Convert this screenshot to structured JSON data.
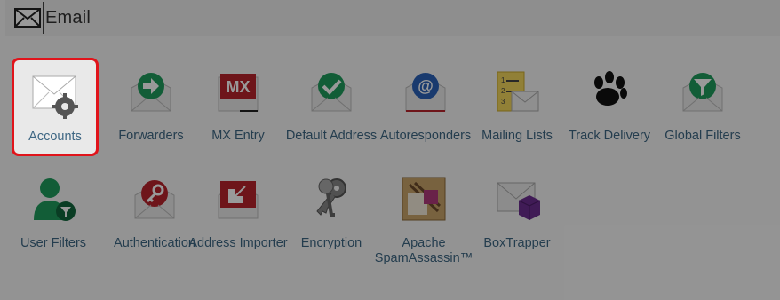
{
  "section": {
    "title": "Email",
    "icon": "envelope-icon"
  },
  "items": [
    {
      "label": "Accounts",
      "icon": "email-accounts-gear-icon",
      "selected": true
    },
    {
      "label": "Forwarders",
      "icon": "forwarder-arrow-icon"
    },
    {
      "label": "MX Entry",
      "icon": "mx-entry-icon",
      "badge": "MX"
    },
    {
      "label": "Default Address",
      "icon": "default-address-check-icon"
    },
    {
      "label": "Autoresponders",
      "icon": "autoresponder-at-icon",
      "badge": "@"
    },
    {
      "label": "Mailing Lists",
      "icon": "mailing-lists-icon"
    },
    {
      "label": "Track Delivery",
      "icon": "track-delivery-pawprint-icon"
    },
    {
      "label": "Global Filters",
      "icon": "global-filters-funnel-icon"
    },
    {
      "label": "User Filters",
      "icon": "user-filters-icon"
    },
    {
      "label": "Authentication",
      "icon": "authentication-key-icon"
    },
    {
      "label": "Address Importer",
      "icon": "address-importer-arrow-icon"
    },
    {
      "label": "Encryption",
      "icon": "encryption-keys-icon"
    },
    {
      "label": "Apache SpamAssassin™",
      "icon": "spamassassin-icon"
    },
    {
      "label": "BoxTrapper",
      "icon": "boxtrapper-icon"
    }
  ],
  "colors": {
    "label": "#3d6683",
    "highlight_border": "#e1141b",
    "green": "#1e9b5c",
    "red": "#b8242c",
    "blue": "#2a62b8",
    "purple": "#6b2d8f"
  }
}
